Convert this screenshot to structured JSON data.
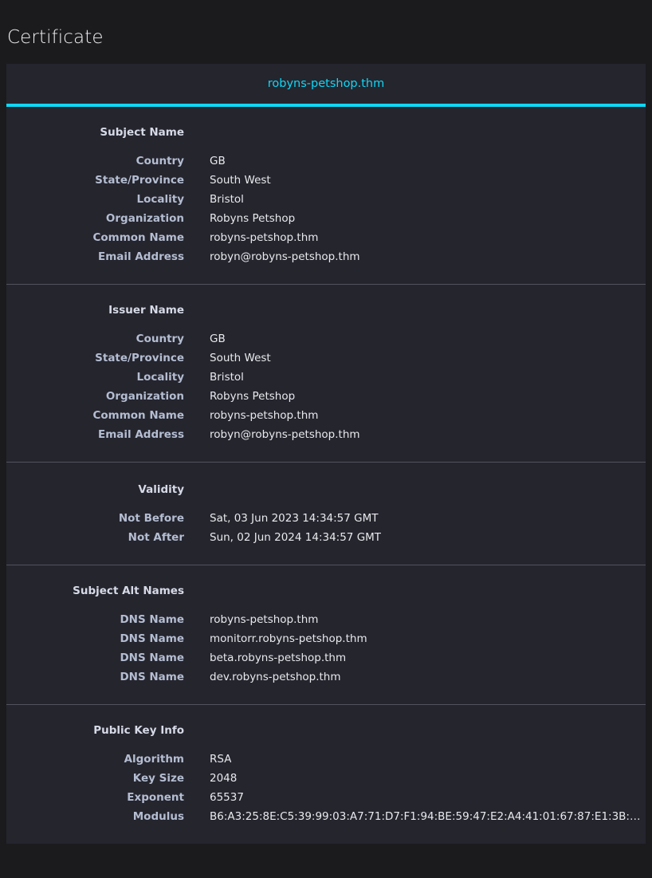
{
  "page": {
    "heading": "Certificate"
  },
  "colors": {
    "page_background": "#1b1b1e",
    "card_background": "#25252e",
    "accent_cyan": "#0fd7f5",
    "label_text": "#b4bdd1",
    "value_text": "#e8e9ed",
    "divider": "#52525e"
  },
  "tabs": [
    {
      "label": "robyns-petshop.thm",
      "selected": true
    }
  ],
  "sections": [
    {
      "title": "Subject Name",
      "rows": [
        {
          "label": "Country",
          "value": "GB"
        },
        {
          "label": "State/Province",
          "value": "South West"
        },
        {
          "label": "Locality",
          "value": "Bristol"
        },
        {
          "label": "Organization",
          "value": "Robyns Petshop"
        },
        {
          "label": "Common Name",
          "value": "robyns-petshop.thm"
        },
        {
          "label": "Email Address",
          "value": "robyn@robyns-petshop.thm"
        }
      ]
    },
    {
      "title": "Issuer Name",
      "rows": [
        {
          "label": "Country",
          "value": "GB"
        },
        {
          "label": "State/Province",
          "value": "South West"
        },
        {
          "label": "Locality",
          "value": "Bristol"
        },
        {
          "label": "Organization",
          "value": "Robyns Petshop"
        },
        {
          "label": "Common Name",
          "value": "robyns-petshop.thm"
        },
        {
          "label": "Email Address",
          "value": "robyn@robyns-petshop.thm"
        }
      ]
    },
    {
      "title": "Validity",
      "rows": [
        {
          "label": "Not Before",
          "value": "Sat, 03 Jun 2023 14:34:57 GMT"
        },
        {
          "label": "Not After",
          "value": "Sun, 02 Jun 2024 14:34:57 GMT"
        }
      ]
    },
    {
      "title": "Subject Alt Names",
      "rows": [
        {
          "label": "DNS Name",
          "value": "robyns-petshop.thm"
        },
        {
          "label": "DNS Name",
          "value": "monitorr.robyns-petshop.thm"
        },
        {
          "label": "DNS Name",
          "value": "beta.robyns-petshop.thm"
        },
        {
          "label": "DNS Name",
          "value": "dev.robyns-petshop.thm"
        }
      ]
    },
    {
      "title": "Public Key Info",
      "rows": [
        {
          "label": "Algorithm",
          "value": "RSA"
        },
        {
          "label": "Key Size",
          "value": "2048"
        },
        {
          "label": "Exponent",
          "value": "65537"
        },
        {
          "label": "Modulus",
          "value": "B6:A3:25:8E:C5:39:99:03:A7:71:D7:F1:94:BE:59:47:E2:A4:41:01:67:87:E1:3B:…"
        }
      ]
    }
  ]
}
